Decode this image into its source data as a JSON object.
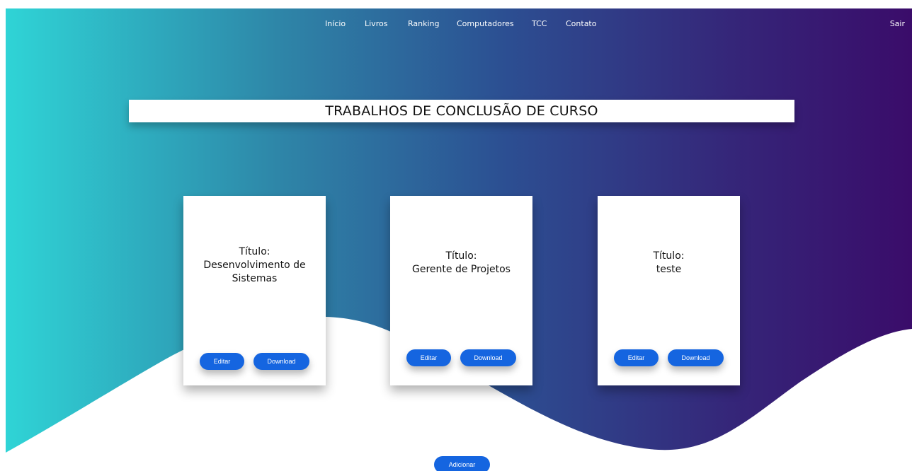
{
  "nav": {
    "items": [
      {
        "label": "Início"
      },
      {
        "label": "Livros"
      },
      {
        "label": "Ranking"
      },
      {
        "label": "Computadores"
      },
      {
        "label": "TCC"
      },
      {
        "label": "Contato"
      }
    ],
    "logout_label": "Sair"
  },
  "page_title": "TRABALHOS DE CONCLUSÃO DE CURSO",
  "cards": [
    {
      "title_label": "Título:",
      "title_value": "Desenvolvimento de Sistemas",
      "edit_label": "Editar",
      "download_label": "Download"
    },
    {
      "title_label": "Título:",
      "title_value": "Gerente de Projetos",
      "edit_label": "Editar",
      "download_label": "Download"
    },
    {
      "title_label": "Título:",
      "title_value": "teste",
      "edit_label": "Editar",
      "download_label": "Download"
    }
  ],
  "add_button_label": "Adicionar",
  "colors": {
    "gradient_start": "#2fd3d6",
    "gradient_mid": "#2e5f9a",
    "gradient_end": "#3a0f6e",
    "button": "#1565e0",
    "card": "#ffffff"
  }
}
